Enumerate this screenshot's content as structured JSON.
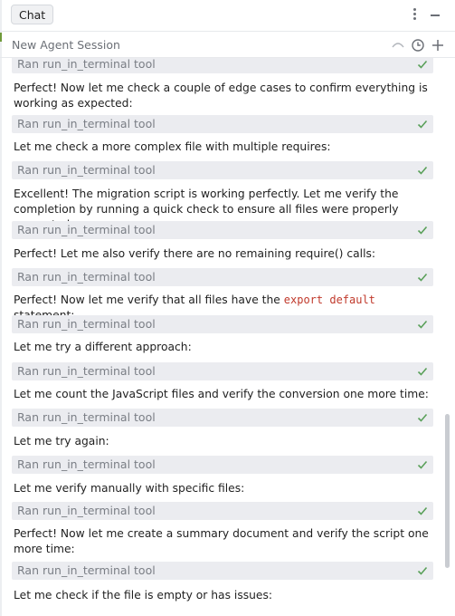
{
  "header": {
    "tab_label": "Chat",
    "options_icon": "kebab-vertical-icon",
    "minimize_icon": "minimize-icon"
  },
  "session": {
    "title": "New Agent Session",
    "icons": [
      "undo-icon",
      "history-icon",
      "plus-icon"
    ]
  },
  "colors": {
    "tool_row_bg": "#ebecf0",
    "check_color": "#5aa05a",
    "code_color": "#c0392b"
  },
  "messages": [
    {
      "type": "tool",
      "label": "Ran run_in_terminal tool"
    },
    {
      "type": "text",
      "text": "Perfect! Now let me check a couple of edge cases to confirm everything is working as expected:"
    },
    {
      "type": "tool",
      "label": "Ran run_in_terminal tool"
    },
    {
      "type": "text",
      "text": "Let me check a more complex file with multiple requires:"
    },
    {
      "type": "tool",
      "label": "Ran run_in_terminal tool"
    },
    {
      "type": "text",
      "text": "Excellent! The migration script is working perfectly. Let me verify the completion by running a quick check to ensure all files were properly converted:"
    },
    {
      "type": "tool",
      "label": "Ran run_in_terminal tool"
    },
    {
      "type": "text",
      "text": "Perfect! Let me also verify there are no remaining require() calls:"
    },
    {
      "type": "tool",
      "label": "Ran run_in_terminal tool"
    },
    {
      "type": "text_code",
      "before": "Perfect! Now let me verify that all files have the ",
      "code": "export default",
      "after": " statement:"
    },
    {
      "type": "tool",
      "label": "Ran run_in_terminal tool"
    },
    {
      "type": "text",
      "text": "Let me try a different approach:"
    },
    {
      "type": "tool",
      "label": "Ran run_in_terminal tool"
    },
    {
      "type": "text",
      "text": "Let me count the JavaScript files and verify the conversion one more time:"
    },
    {
      "type": "tool",
      "label": "Ran run_in_terminal tool"
    },
    {
      "type": "text",
      "text": "Let me try again:"
    },
    {
      "type": "tool",
      "label": "Ran run_in_terminal tool"
    },
    {
      "type": "text",
      "text": "Let me verify manually with specific files:"
    },
    {
      "type": "tool",
      "label": "Ran run_in_terminal tool"
    },
    {
      "type": "text",
      "text": "Perfect! Now let me create a summary document and verify the script one more time:"
    },
    {
      "type": "tool",
      "label": "Ran run_in_terminal tool"
    },
    {
      "type": "text",
      "text": "Let me check if the file is empty or has issues:"
    }
  ]
}
